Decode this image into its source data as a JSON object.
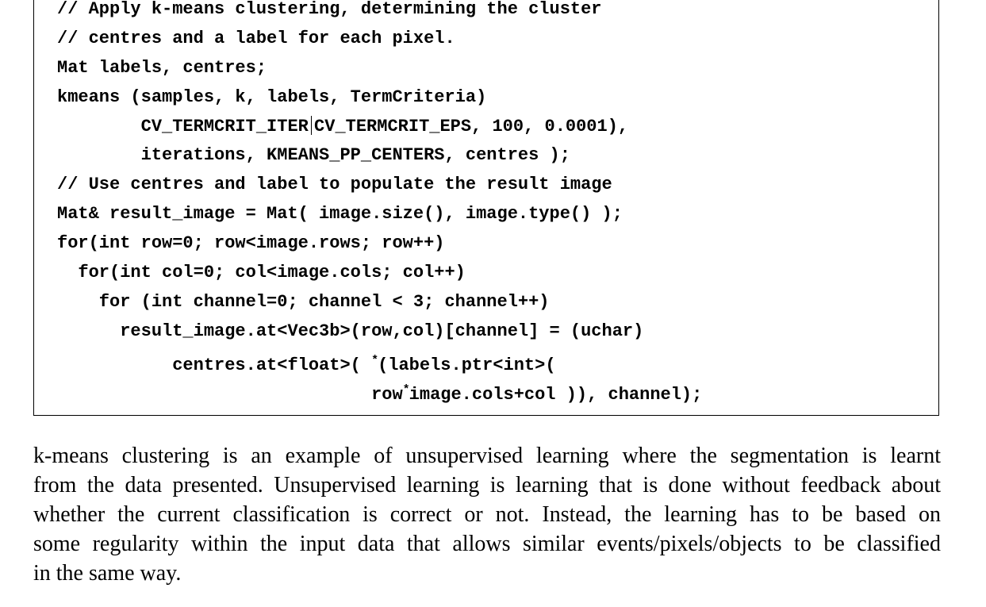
{
  "code": {
    "lines": [
      "// Apply k-means clustering, determining the cluster",
      "// centres and a label for each pixel.",
      "Mat labels, centres;",
      "kmeans (samples, k, labels, TermCriteria)",
      "        CV_TERMCRIT_ITER",
      "CV_TERMCRIT_EPS, 100, 0.0001),",
      "        iterations, KMEANS_PP_CENTERS, centres );",
      "// Use centres and label to populate the result image",
      "Mat& result_image = Mat( image.size(), image.type() );",
      "for(int row=0; row<image.rows; row++)",
      "  for(int col=0; col<image.cols; col++)",
      "    for (int channel=0; channel < 3; channel++)",
      "      result_image.at<Vec3b>(row,col)[channel] = (uchar)",
      "           centres.at<float>( ",
      "(labels.ptr<int>(",
      "                              row",
      "image.cols+col )), channel);"
    ],
    "pipe_symbol": "|",
    "star_symbol": "*"
  },
  "prose": {
    "lines": [
      "k-means clustering is an example of unsupervised learning where the segmentation is learnt",
      "from the data presented. Unsupervised learning is learning that is done without feedback about",
      "whether the current classification is correct or not. Instead, the learning has to be based on",
      "some regularity within the input data that allows similar events/pixels/objects to be classified",
      "in the same way."
    ]
  }
}
